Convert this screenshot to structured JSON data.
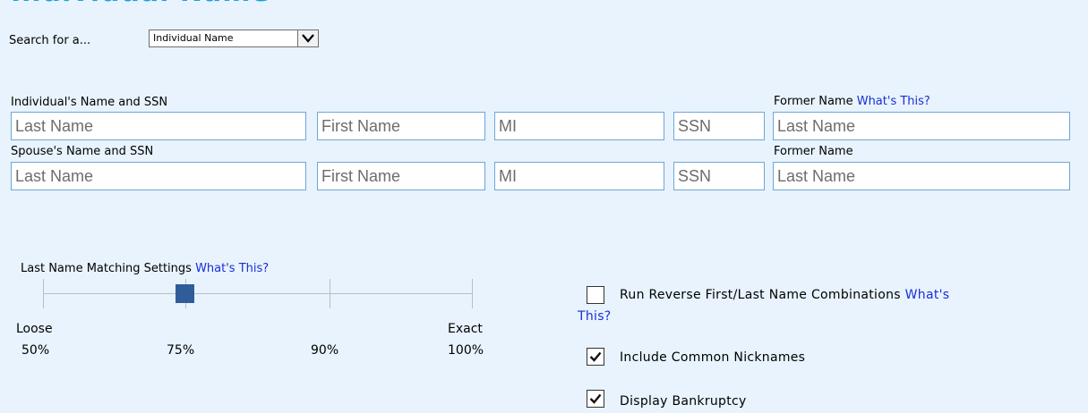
{
  "page": {
    "title_fragment": "Individual Name"
  },
  "search": {
    "label": "Search for a...",
    "selected_option": "Individual Name"
  },
  "individual": {
    "section_label": "Individual's Name and SSN",
    "former_label": "Former Name",
    "whats_this": "What's This?",
    "last_placeholder": "Last Name",
    "first_placeholder": "First Name",
    "mi_placeholder": "MI",
    "ssn_placeholder": "SSN",
    "former_placeholder": "Last Name"
  },
  "spouse": {
    "section_label": "Spouse's Name and SSN",
    "former_label": "Former Name",
    "last_placeholder": "Last Name",
    "first_placeholder": "First Name",
    "mi_placeholder": "MI",
    "ssn_placeholder": "SSN",
    "former_placeholder": "Last Name"
  },
  "matching": {
    "label": "Last Name Matching Settings",
    "whats_this": "What's This?",
    "loose_label": "Loose",
    "exact_label": "Exact",
    "ticks": [
      "50%",
      "75%",
      "90%",
      "100%"
    ],
    "selected": "75%"
  },
  "options": {
    "reverse": {
      "label_part1": "Run Reverse First/Last Name Combinations ",
      "link_part1": "What's",
      "link_part2": "This?",
      "checked": false
    },
    "nicknames": {
      "label": "Include Common Nicknames",
      "checked": true
    },
    "bankruptcy": {
      "label": "Display Bankruptcy",
      "checked": true
    }
  },
  "colors": {
    "panel_bg": "#e8f3fd",
    "link": "#1a2ed8",
    "title": "#1aa2d8",
    "slider_knob": "#305d9a",
    "input_border": "#6fa6d6"
  }
}
